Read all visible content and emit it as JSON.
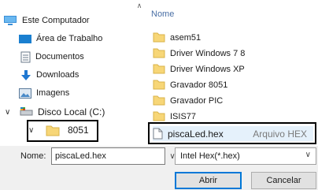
{
  "nav": {
    "items": [
      {
        "label": "Este Computador",
        "icon": "computer-icon"
      },
      {
        "label": "Área de Trabalho",
        "icon": "desktop-icon"
      },
      {
        "label": "Documentos",
        "icon": "documents-icon"
      },
      {
        "label": "Downloads",
        "icon": "download-icon"
      },
      {
        "label": "Imagens",
        "icon": "pictures-icon"
      },
      {
        "label": "Disco Local (C:)",
        "icon": "drive-icon"
      },
      {
        "label": "8051",
        "icon": "folder-icon"
      }
    ]
  },
  "files": {
    "column_name": "Nome",
    "folders": [
      "asem51",
      "Driver Windows 7 8",
      "Driver Windows XP",
      "Gravador 8051",
      "Gravador PIC",
      "ISIS77"
    ],
    "selected_file": {
      "name": "piscaLed.hex",
      "type": "Arquivo HEX"
    }
  },
  "bottom": {
    "name_label": "Nome:",
    "filename": "piscaLed.hex",
    "file_type": "Intel Hex(*.hex)",
    "open_label": "Abrir",
    "cancel_label": "Cancelar"
  },
  "colors": {
    "folder": "#f7d677",
    "selection": "#e5f1fb",
    "accent": "#0078d7"
  }
}
